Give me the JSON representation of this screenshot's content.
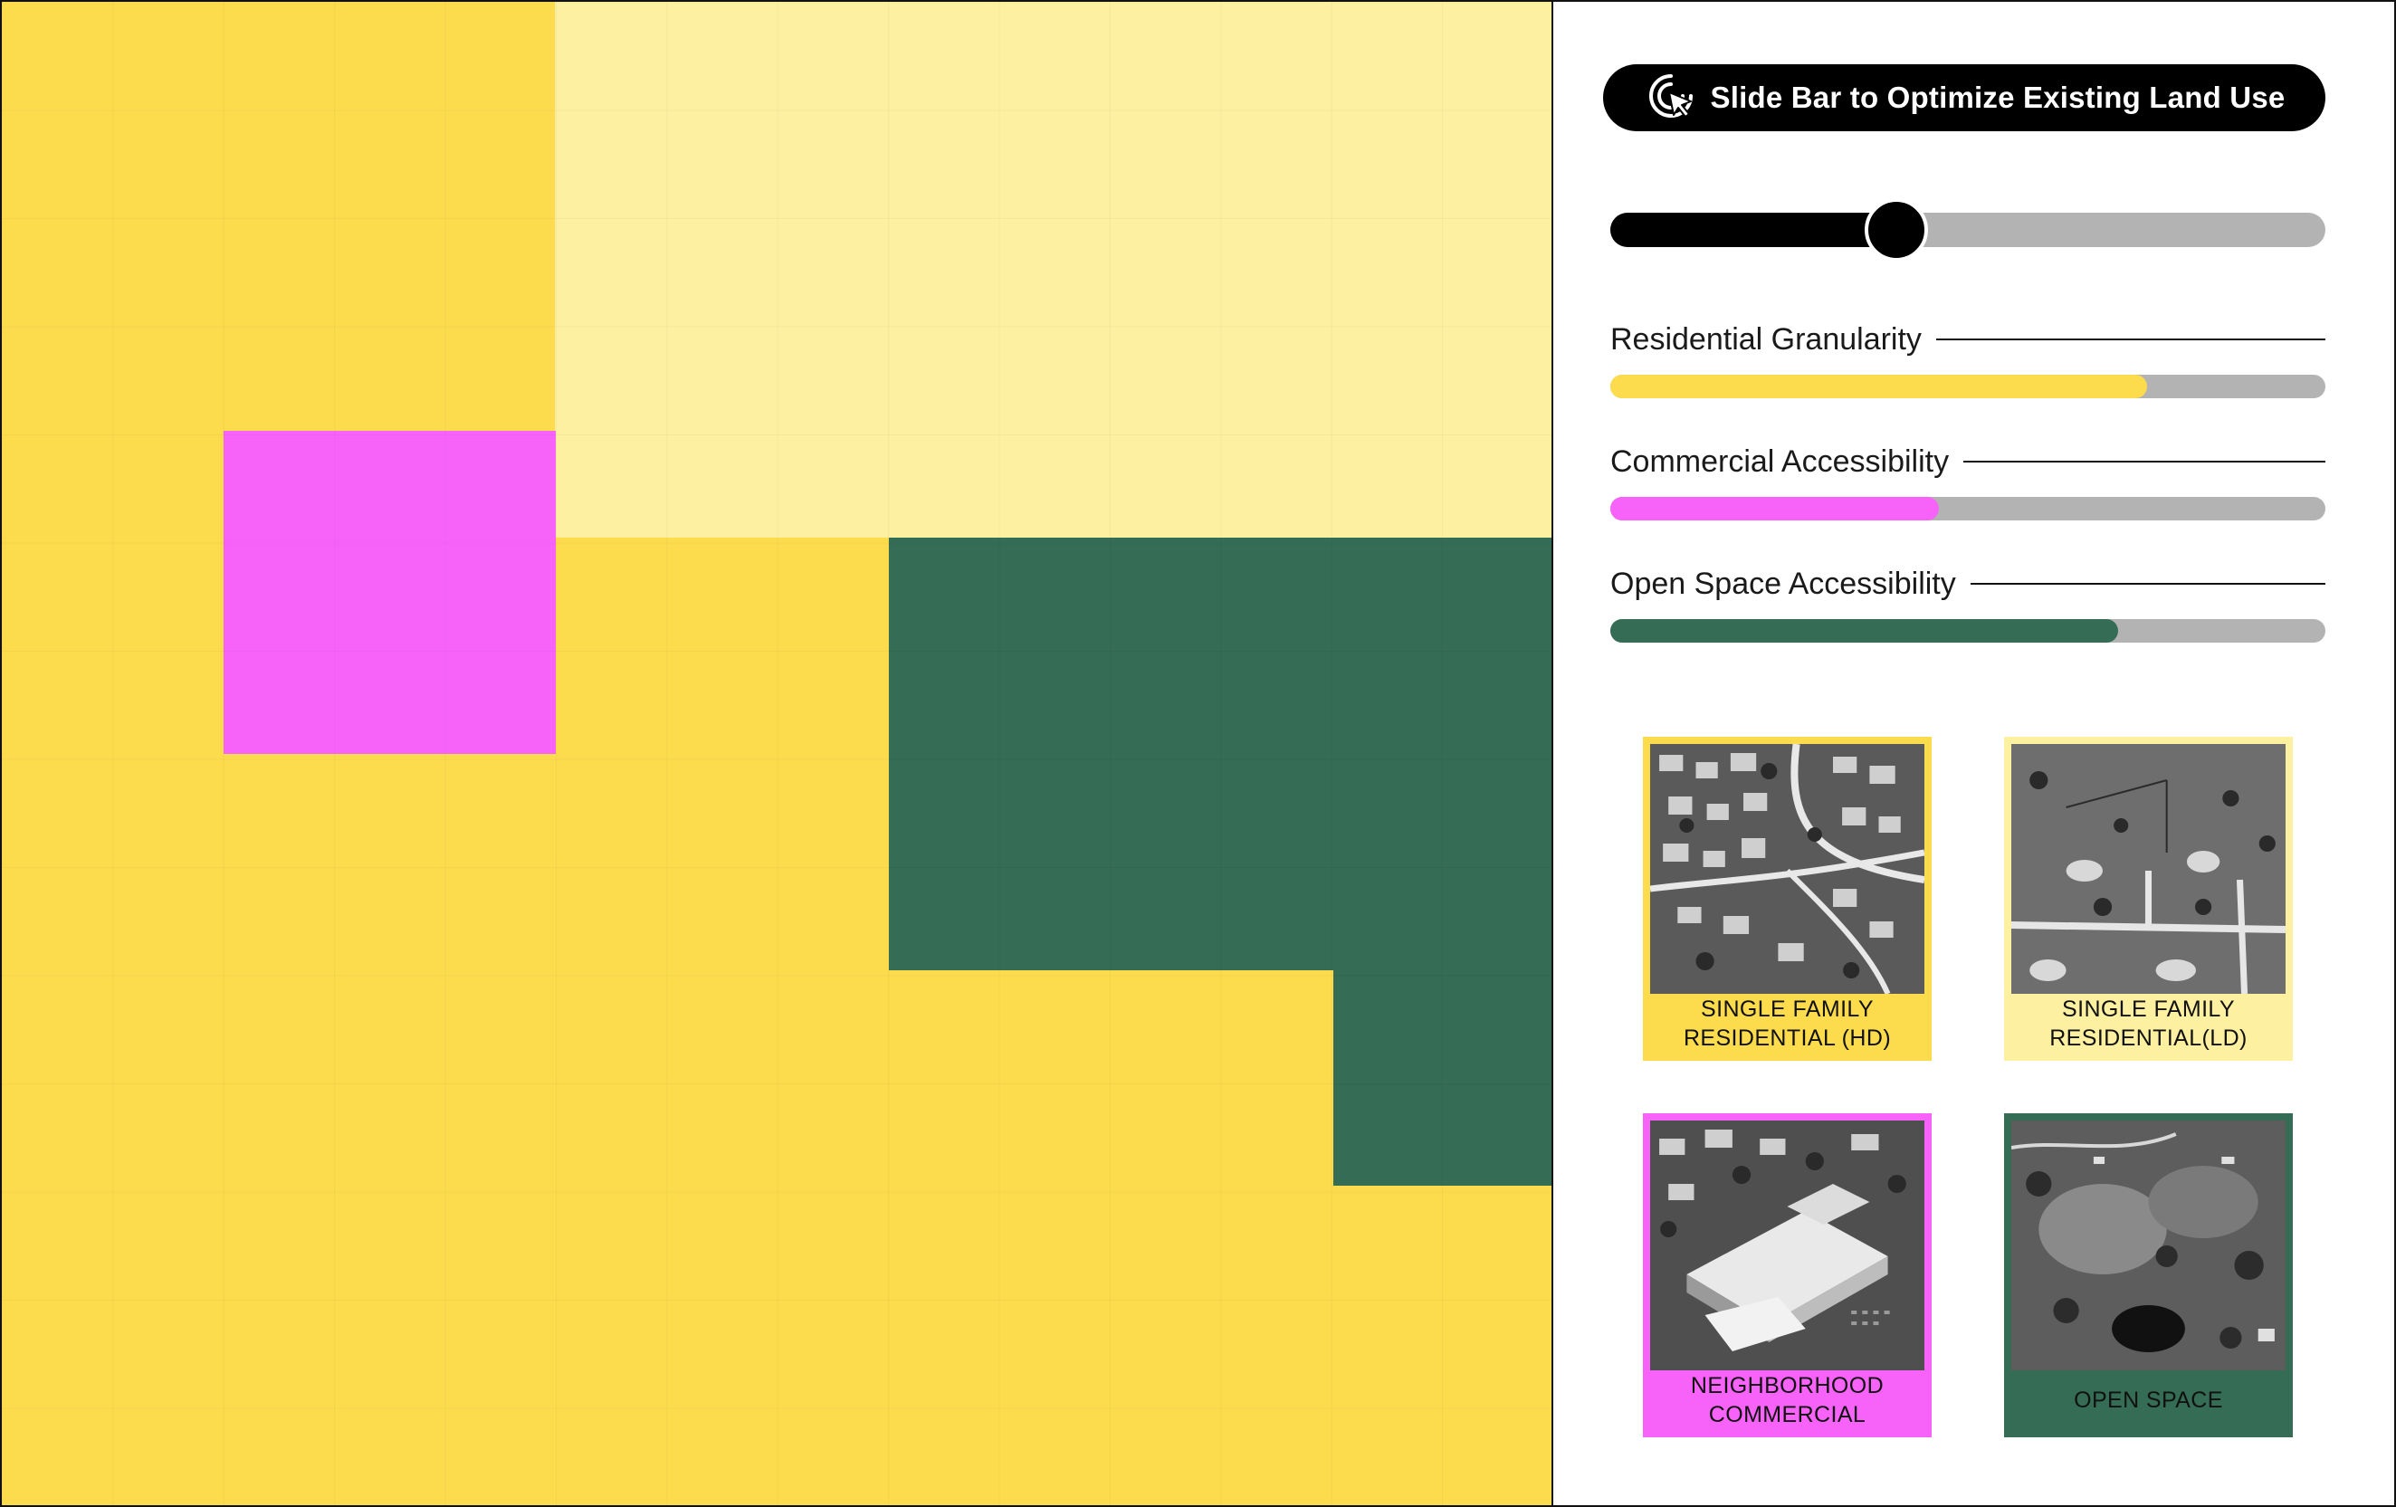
{
  "header": {
    "optimize_label": "Slide Bar to Optimize Existing Land Use",
    "icon": "cursor-click-icon"
  },
  "slider": {
    "value": 0.4
  },
  "metrics": [
    {
      "label": "Residential Granularity",
      "value": 0.75,
      "color": "#fcdc4d"
    },
    {
      "label": "Commercial Accessibility",
      "value": 0.46,
      "color": "#f763f9"
    },
    {
      "label": "Open Space Accessibility",
      "value": 0.71,
      "color": "#346c55"
    }
  ],
  "legend": [
    {
      "caption": "SINGLE FAMILY\nRESIDENTIAL (HD)",
      "color": "#fcdc4d"
    },
    {
      "caption": "SINGLE FAMILY\nRESIDENTIAL(LD)",
      "color": "#fef0a1"
    },
    {
      "caption": "NEIGHBORHOOD\nCOMMERCIAL",
      "color": "#f763f9"
    },
    {
      "caption": "OPEN SPACE",
      "color": "#346c55"
    }
  ],
  "colors": {
    "residential_hd": "#fcdc4d",
    "residential_ld": "#fef0a1",
    "commercial": "#f763f9",
    "open_space": "#346c55",
    "track": "#b3b3b3"
  }
}
